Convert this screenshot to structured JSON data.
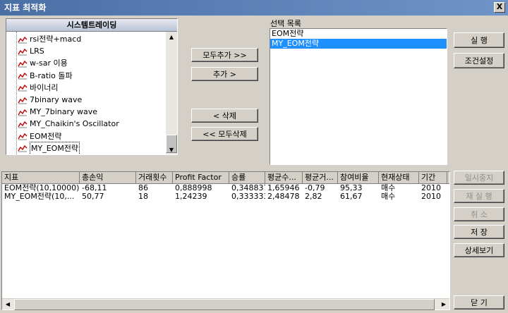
{
  "window": {
    "title": "지표 최적화",
    "close_label": "X"
  },
  "tree": {
    "header": "시스템트레이딩",
    "items": [
      {
        "label": "rsi전략+macd"
      },
      {
        "label": "LRS"
      },
      {
        "label": "w-sar 이용"
      },
      {
        "label": "B-ratio 돌파"
      },
      {
        "label": "바이너리"
      },
      {
        "label": "7binary wave"
      },
      {
        "label": "MY_7binary wave"
      },
      {
        "label": "MY_Chaikin's Oscillator"
      },
      {
        "label": "EOM전략"
      },
      {
        "label": "MY_EOM전략"
      }
    ]
  },
  "middle_buttons": {
    "add_all": "모두추가 >>",
    "add": "추가 >",
    "delete": "< 삭제",
    "delete_all": "<< 모두삭제"
  },
  "selection": {
    "label": "선택 목록",
    "items": [
      {
        "label": "EOM전략",
        "selected": false
      },
      {
        "label": "MY_EOM전략",
        "selected": true
      }
    ]
  },
  "right_buttons": {
    "run": "실    행",
    "settings": "조건설정",
    "pause": "일시중지",
    "rerun": "재 실 행",
    "cancel": "취    소",
    "save": "저    장",
    "details": "상세보기",
    "close": "닫    기"
  },
  "results": {
    "columns": [
      "지표",
      "총손익",
      "거래횟수",
      "Profit Factor",
      "승률",
      "평균수...",
      "평균거...",
      "참여비율",
      "현재상태",
      "기간"
    ],
    "rows": [
      [
        "EOM전략(10,10000)",
        "-68,11",
        "86",
        "0,888998",
        "0,348837",
        "1,65946",
        "-0,79",
        "95,33",
        "매수",
        "2010"
      ],
      [
        "MY_EOM전략(10,...",
        "50,77",
        "18",
        "1,24239",
        "0,333333",
        "2,48478",
        "2,82",
        "61,67",
        "매수",
        "2010"
      ]
    ]
  },
  "colors": {
    "title_bar": "#4a6fa5",
    "selection": "#1e90ff",
    "face": "#d4d0c8"
  },
  "icons": {
    "strategy": "line-chart-icon"
  }
}
